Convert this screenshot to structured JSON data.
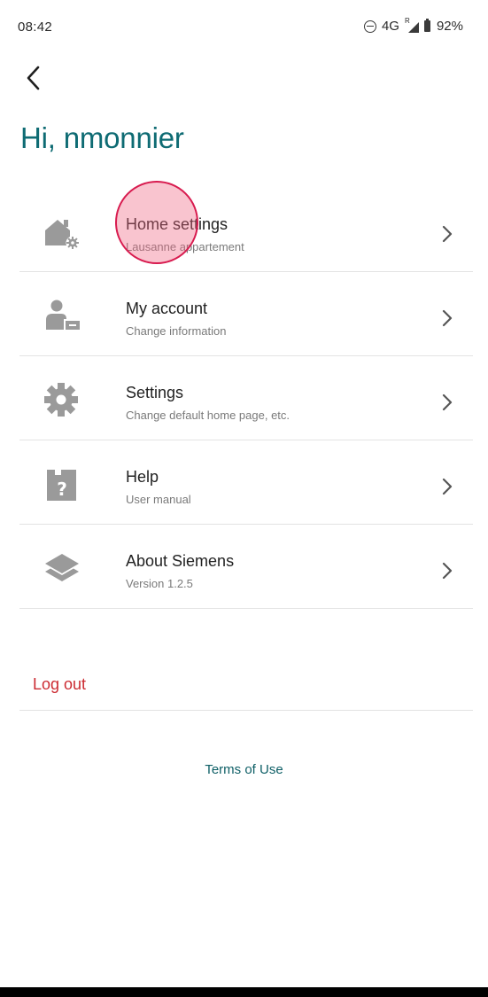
{
  "status_bar": {
    "time": "08:42",
    "network": "4G",
    "roaming": "R",
    "battery": "92%"
  },
  "header": {
    "greeting": "Hi, nmonnier"
  },
  "menu": {
    "items": [
      {
        "title": "Home settings",
        "subtitle": "Lausanne appartement",
        "icon": "home-gear-icon"
      },
      {
        "title": "My account",
        "subtitle": "Change information",
        "icon": "user-card-icon"
      },
      {
        "title": "Settings",
        "subtitle": "Change default home page, etc.",
        "icon": "gear-icon"
      },
      {
        "title": "Help",
        "subtitle": "User manual",
        "icon": "help-book-icon"
      },
      {
        "title": "About Siemens",
        "subtitle": "Version 1.2.5",
        "icon": "layers-icon"
      }
    ]
  },
  "logout": {
    "label": "Log out"
  },
  "footer": {
    "terms": "Terms of Use"
  },
  "colors": {
    "accent": "#0e6b73",
    "logout": "#cc2b32",
    "icon": "#9a9a9a",
    "divider": "#e3e3e3"
  }
}
